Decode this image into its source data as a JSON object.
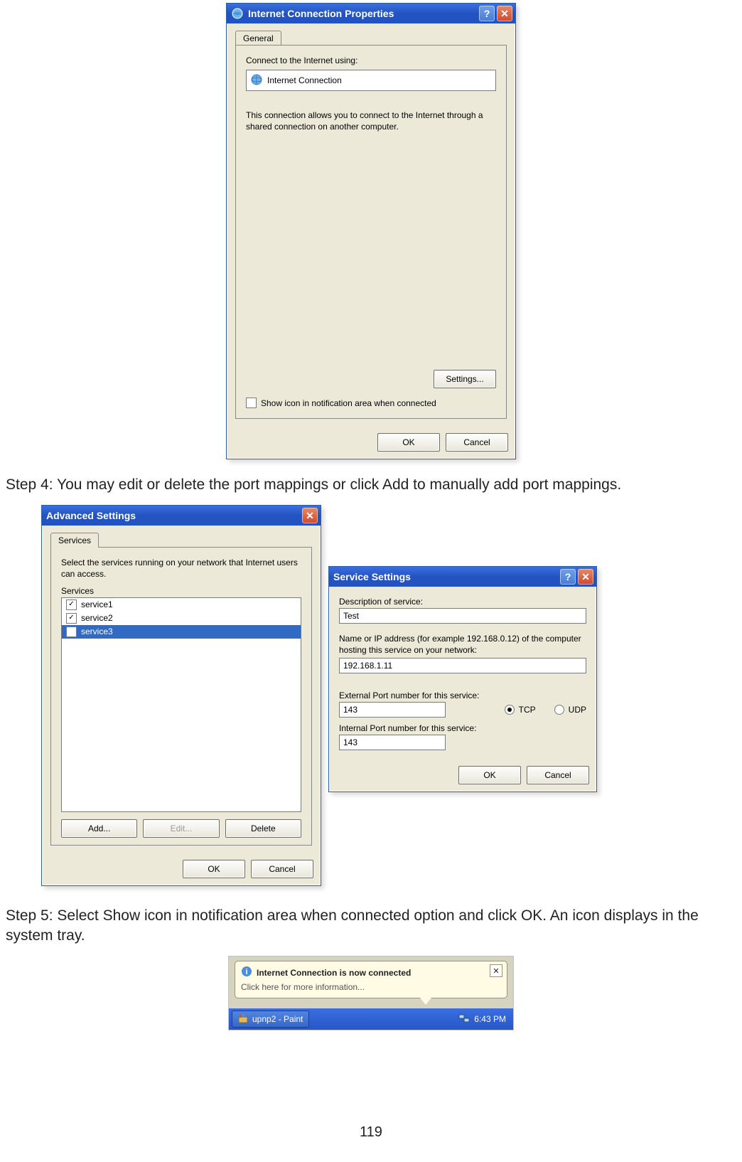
{
  "step4_text": "Step 4: You may edit or delete the port mappings or click Add to manually add port mappings.",
  "step5_text": "Step 5: Select Show icon in notification area when connected option and click OK. An icon displays in the system tray.",
  "page_number": "119",
  "dialog1": {
    "title": "Internet Connection Properties",
    "tab1": "General",
    "connect_label": "Connect to the Internet using:",
    "connection_name": "Internet Connection",
    "description": "This connection allows you to connect to the Internet through a shared connection on another computer.",
    "settings_btn": "Settings...",
    "show_icon_label": "Show icon in notification area when connected",
    "show_icon_checked": false,
    "ok_btn": "OK",
    "cancel_btn": "Cancel"
  },
  "dialog2": {
    "title": "Advanced Settings",
    "tab1": "Services",
    "instruction": "Select the services running on your network that Internet users can access.",
    "services_label": "Services",
    "services": [
      {
        "label": "service1",
        "checked": true,
        "selected": false
      },
      {
        "label": "service2",
        "checked": true,
        "selected": false
      },
      {
        "label": "service3",
        "checked": true,
        "selected": true
      }
    ],
    "add_btn": "Add...",
    "edit_btn": "Edit...",
    "delete_btn": "Delete",
    "ok_btn": "OK",
    "cancel_btn": "Cancel"
  },
  "dialog3": {
    "title": "Service Settings",
    "desc_label": "Description of service:",
    "desc_value": "Test",
    "host_label": "Name or IP address (for example 192.168.0.12) of the computer hosting this service on your network:",
    "host_value": "192.168.1.11",
    "ext_port_label": "External Port number for this service:",
    "ext_port_value": "143",
    "int_port_label": "Internal Port number for this service:",
    "int_port_value": "143",
    "tcp_label": "TCP",
    "udp_label": "UDP",
    "protocol_selected": "TCP",
    "ok_btn": "OK",
    "cancel_btn": "Cancel"
  },
  "balloon": {
    "title": "Internet Connection is now connected",
    "body": "Click here for more information...",
    "task_label": "upnp2 - Paint",
    "clock": "6:43 PM"
  }
}
